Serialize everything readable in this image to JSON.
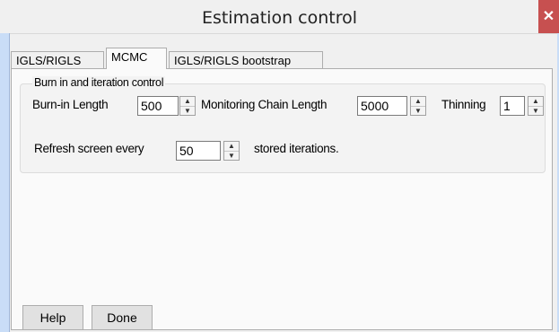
{
  "window": {
    "title": "Estimation control"
  },
  "tabs": [
    {
      "label": "IGLS/RIGLS"
    },
    {
      "label": "MCMC"
    },
    {
      "label": "IGLS/RIGLS bootstrap"
    }
  ],
  "group": {
    "title": "Burn in and iteration control",
    "burn_in_label": "Burn-in Length",
    "burn_in_value": "500",
    "monitor_label": "Monitoring Chain Length",
    "monitor_value": "5000",
    "thinning_label": "Thinning",
    "thinning_value": "1",
    "refresh_label": "Refresh screen every",
    "refresh_value": "50",
    "refresh_suffix": "stored iterations."
  },
  "buttons": {
    "help": "Help",
    "done": "Done"
  },
  "icons": {
    "close": "close-icon",
    "spin_up": "chevron-up-icon",
    "spin_down": "chevron-down-icon"
  }
}
